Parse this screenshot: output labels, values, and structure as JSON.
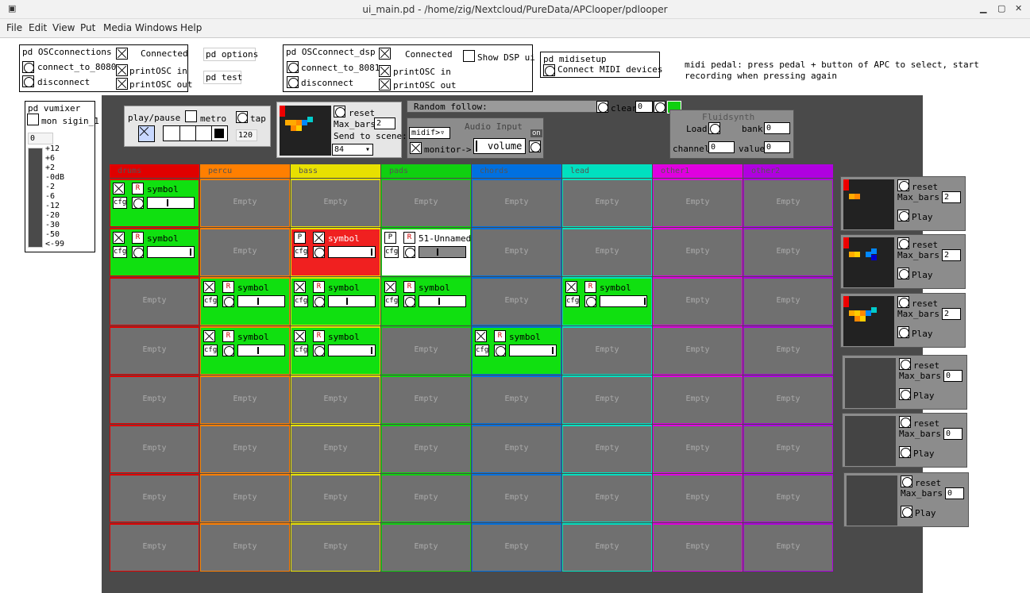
{
  "window": {
    "title": "ui_main.pd  - /home/zig/Nextcloud/PureData/APClooper/pdlooper"
  },
  "menu": [
    "File",
    "Edit",
    "View",
    "Put",
    "Media",
    "Windows",
    "Help"
  ],
  "osc": {
    "title": "pd OSCconnections",
    "connect": "connect_to_8080",
    "disconnect": "disconnect",
    "connected": "Connected",
    "print_in": "printOSC in",
    "print_out": "printOSC out"
  },
  "options": "pd options",
  "test": "pd test",
  "dsp": {
    "title": "pd OSCconnect_dsp",
    "connect": "connect_to_8081",
    "disconnect": "disconnect",
    "connected": "Connected",
    "show": "Show DSP ui",
    "print_in": "printOSC in",
    "print_out": "printOSC out"
  },
  "midisetup": {
    "title": "pd midisetup",
    "connect": "Connect MIDI devices"
  },
  "note": {
    "line1": "midi pedal: press pedal + button of APC to select, start",
    "line2": "recording when pressing again"
  },
  "vumixer": {
    "title": "pd vumixer",
    "mon": "mon sigin_1",
    "value": "0",
    "scale": [
      "+12",
      "+6",
      "+2",
      "-0dB",
      "-2",
      "-6",
      "-12",
      "-20",
      "-30",
      "-50",
      "<-99"
    ]
  },
  "transport": {
    "play": "play/pause",
    "metro": "metro",
    "tap": "tap",
    "bpm": "120"
  },
  "scene": {
    "reset": "reset",
    "maxbars": "Max_bars",
    "maxbars_val": "2",
    "send": "Send to scene:",
    "scene_val": "84"
  },
  "random": {
    "label": "Random follow:",
    "clear": "clear",
    "val": "0"
  },
  "audio": {
    "midif": "midif>",
    "title": "Audio Input",
    "monitor": "monitor->",
    "volume": "volume",
    "on": "on"
  },
  "fluid": {
    "title": "Fluidsynth",
    "load": "Load",
    "bank": "bank",
    "bank_val": "0",
    "channel": "channel",
    "channel_val": "0",
    "value": "value",
    "value_val": "0"
  },
  "tracks": [
    "drums",
    "percu",
    "bass",
    "pads",
    "chords",
    "lead",
    "other1",
    "other2"
  ],
  "track_colors": [
    "#e00000",
    "#ff7f00",
    "#e8e000",
    "#10d010",
    "#0070e0",
    "#00e0c0",
    "#e000e0",
    "#b000e0"
  ],
  "empty": "Empty",
  "clip": {
    "name": "symbol",
    "cfg": "cfg",
    "s": "S",
    "r": "R",
    "p": "P",
    "unnamed": "51-Unnamed"
  },
  "side": [
    {
      "reset": "reset",
      "max": "Max_bars",
      "val": "2",
      "play": "Play"
    },
    {
      "reset": "reset",
      "max": "Max_bars",
      "val": "2",
      "play": "Play"
    },
    {
      "reset": "reset",
      "max": "Max_bars",
      "val": "2",
      "play": "Play"
    },
    {
      "reset": "reset",
      "max": "Max_bars",
      "val": "0",
      "play": "Play"
    },
    {
      "reset": "reset",
      "max": "Max_bars",
      "val": "0",
      "play": "Play"
    },
    {
      "reset": "reset",
      "max": "Max_bars",
      "val": "0",
      "play": "Play"
    }
  ]
}
